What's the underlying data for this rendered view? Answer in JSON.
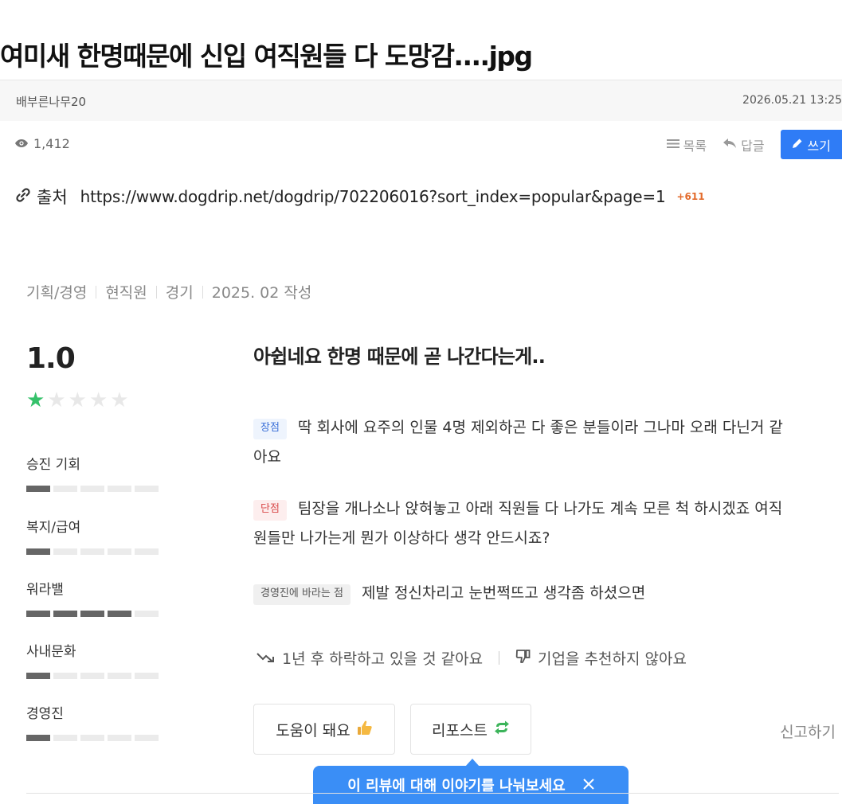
{
  "post": {
    "title": "여미새 한명때문에 신입 여직원들 다 도망감....jpg",
    "author": "배부른나무20",
    "date": "2026.05.21 13:25",
    "views": "1,412",
    "toolbar": {
      "list_label": "목록",
      "reply_label": "답글",
      "write_label": "쓰기"
    },
    "source": {
      "label": "출처",
      "url": "https://www.dogdrip.net/dogdrip/702206016?sort_index=popular&page=1",
      "count": "+611"
    }
  },
  "review": {
    "meta": {
      "job": "기획/경영",
      "status": "현직원",
      "region": "경기",
      "written": "2025. 02 작성"
    },
    "rating": "1.0",
    "stars": {
      "filled": 1,
      "total": 5
    },
    "categories": [
      {
        "label": "승진 기회",
        "score": 1
      },
      {
        "label": "복지/급여",
        "score": 1
      },
      {
        "label": "워라밸",
        "score": 4
      },
      {
        "label": "사내문화",
        "score": 1
      },
      {
        "label": "경영진",
        "score": 1
      }
    ],
    "title": "아쉽네요 한명 때문에 곧 나간다는게..",
    "pros": {
      "badge": "장점",
      "line1": "딱 회사에 요주의 인물 4명 제외하곤 다 좋은 분들이라 그나마 오래 다닌거 같",
      "line2": "아요"
    },
    "cons": {
      "badge": "단점",
      "line1": "팀장을 개나소나 앉혀놓고 아래 직원들 다 나가도 계속 모른 척 하시겠죠 여직",
      "line2": "원들만 나가는게 뭔가 이상하다 생각 안드시죠?"
    },
    "to_management": {
      "badge": "경영진에 바라는 점",
      "text": "제발 정신차리고 눈번쩍뜨고 생각좀 하셨으면"
    },
    "outlook": "1년 후 하락하고 있을 것 같아요",
    "recommend": "기업을 추천하지 않아요",
    "helpful_label": "도움이 돼요",
    "repost_label": "리포스트",
    "report_label": "신고하기",
    "tooltip": "이 리뷰에 대해 이야기를 나눠보세요"
  },
  "colors": {
    "accent": "#2f7cf6",
    "star": "#35c16a",
    "tooltip": "#3a8ef6",
    "source_count": "#e36b2c"
  }
}
